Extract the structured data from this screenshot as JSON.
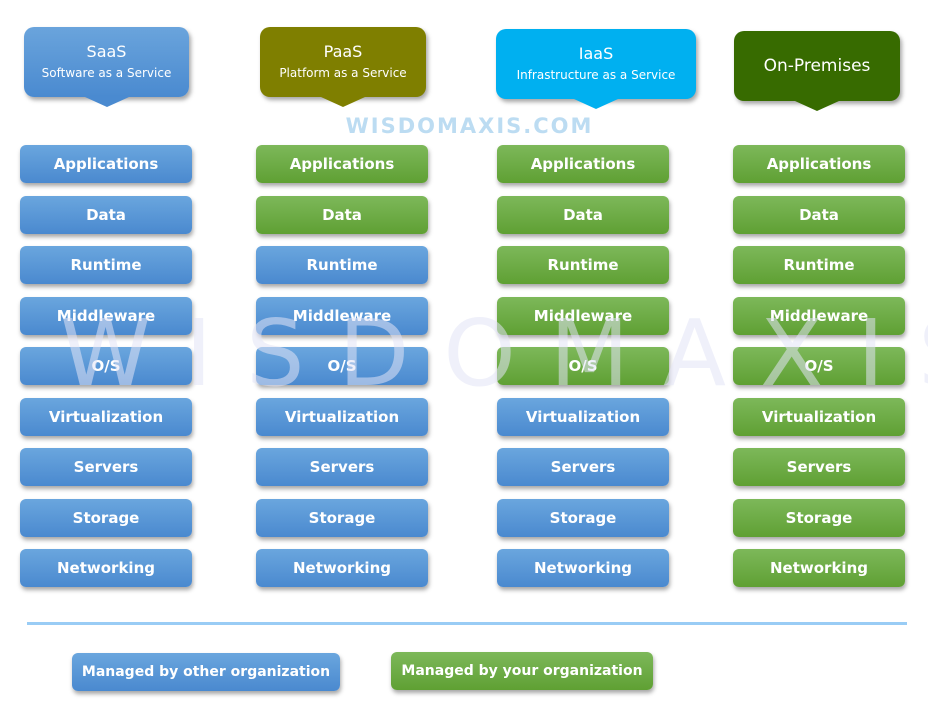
{
  "headers": [
    {
      "title": "SaaS",
      "subtitle": "Software as a Service",
      "color": "#5b9bd5"
    },
    {
      "title": "PaaS",
      "subtitle": "Platform as a Service",
      "color": "#7f7f00"
    },
    {
      "title": "IaaS",
      "subtitle": "Infrastructure as a Service",
      "color": "#00b0f0"
    },
    {
      "title": "On-Premises",
      "subtitle": "",
      "color": "#376b00"
    }
  ],
  "watermark": {
    "small": "WISDOMAXIS.COM",
    "large": "WISDOMAXIS"
  },
  "columns": [
    {
      "name": "SaaS",
      "layers": [
        {
          "label": "Applications",
          "managed_by": "other"
        },
        {
          "label": "Data",
          "managed_by": "other"
        },
        {
          "label": "Runtime",
          "managed_by": "other"
        },
        {
          "label": "Middleware",
          "managed_by": "other"
        },
        {
          "label": "O/S",
          "managed_by": "other"
        },
        {
          "label": "Virtualization",
          "managed_by": "other"
        },
        {
          "label": "Servers",
          "managed_by": "other"
        },
        {
          "label": "Storage",
          "managed_by": "other"
        },
        {
          "label": "Networking",
          "managed_by": "other"
        }
      ]
    },
    {
      "name": "PaaS",
      "layers": [
        {
          "label": "Applications",
          "managed_by": "yours"
        },
        {
          "label": "Data",
          "managed_by": "yours"
        },
        {
          "label": "Runtime",
          "managed_by": "other"
        },
        {
          "label": "Middleware",
          "managed_by": "other"
        },
        {
          "label": "O/S",
          "managed_by": "other"
        },
        {
          "label": "Virtualization",
          "managed_by": "other"
        },
        {
          "label": "Servers",
          "managed_by": "other"
        },
        {
          "label": "Storage",
          "managed_by": "other"
        },
        {
          "label": "Networking",
          "managed_by": "other"
        }
      ]
    },
    {
      "name": "IaaS",
      "layers": [
        {
          "label": "Applications",
          "managed_by": "yours"
        },
        {
          "label": "Data",
          "managed_by": "yours"
        },
        {
          "label": "Runtime",
          "managed_by": "yours"
        },
        {
          "label": "Middleware",
          "managed_by": "yours"
        },
        {
          "label": "O/S",
          "managed_by": "yours"
        },
        {
          "label": "Virtualization",
          "managed_by": "other"
        },
        {
          "label": "Servers",
          "managed_by": "other"
        },
        {
          "label": "Storage",
          "managed_by": "other"
        },
        {
          "label": "Networking",
          "managed_by": "other"
        }
      ]
    },
    {
      "name": "On-Premises",
      "layers": [
        {
          "label": "Applications",
          "managed_by": "yours"
        },
        {
          "label": "Data",
          "managed_by": "yours"
        },
        {
          "label": "Runtime",
          "managed_by": "yours"
        },
        {
          "label": "Middleware",
          "managed_by": "yours"
        },
        {
          "label": "O/S",
          "managed_by": "yours"
        },
        {
          "label": "Virtualization",
          "managed_by": "yours"
        },
        {
          "label": "Servers",
          "managed_by": "yours"
        },
        {
          "label": "Storage",
          "managed_by": "yours"
        },
        {
          "label": "Networking",
          "managed_by": "yours"
        }
      ]
    }
  ],
  "legend": {
    "other": {
      "label": "Managed by other organization",
      "color": "#5b9bd5"
    },
    "yours": {
      "label": "Managed by your organization",
      "color": "#70ad47"
    }
  }
}
